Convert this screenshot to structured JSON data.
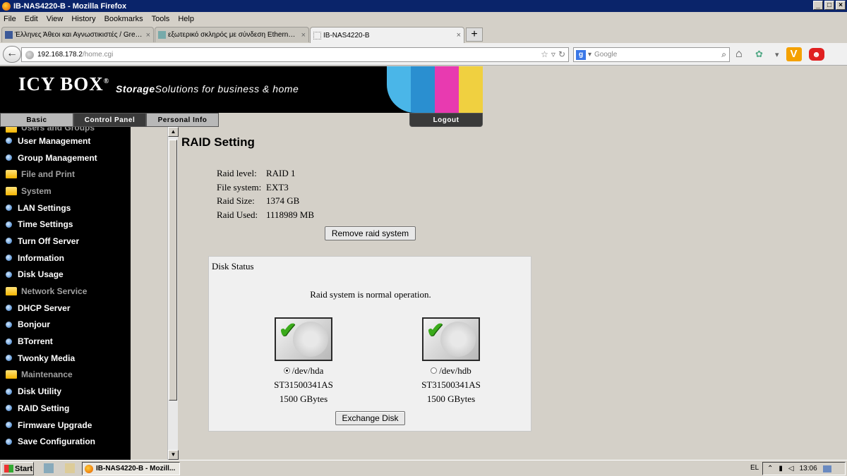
{
  "window": {
    "title": "IB-NAS4220-B - Mozilla Firefox"
  },
  "menu": [
    "File",
    "Edit",
    "View",
    "History",
    "Bookmarks",
    "Tools",
    "Help"
  ],
  "tabs": [
    {
      "label": "Έλληνες Άθεοι και Αγνωστικιστές / Gree...",
      "active": false
    },
    {
      "label": "εξωτερικό σκληρός με σύνδεση Ethernet ...",
      "active": false
    },
    {
      "label": "IB-NAS4220-B",
      "active": true
    }
  ],
  "address": {
    "host": "192.168.178.2",
    "path": "/home.cgi"
  },
  "search": {
    "placeholder": "Google"
  },
  "header": {
    "brand": "ICY BOX",
    "brand_mark": "®",
    "tagline_bold": "Storage",
    "tagline_rest": "Solutions for business & home"
  },
  "topnav": {
    "basic": "Basic",
    "control_panel": "Control Panel",
    "personal_info": "Personal Info",
    "logout": "Logout"
  },
  "sidebar": {
    "partial": "Users and Groups",
    "items": [
      {
        "label": "User Management",
        "kind": "item"
      },
      {
        "label": "Group Management",
        "kind": "item"
      },
      {
        "label": "File and Print",
        "kind": "category"
      },
      {
        "label": "System",
        "kind": "category"
      },
      {
        "label": "LAN Settings",
        "kind": "item"
      },
      {
        "label": "Time Settings",
        "kind": "item"
      },
      {
        "label": "Turn Off Server",
        "kind": "item"
      },
      {
        "label": "Information",
        "kind": "item"
      },
      {
        "label": "Disk Usage",
        "kind": "item"
      },
      {
        "label": "Network Service",
        "kind": "category"
      },
      {
        "label": "DHCP Server",
        "kind": "item"
      },
      {
        "label": "Bonjour",
        "kind": "item"
      },
      {
        "label": "BTorrent",
        "kind": "item"
      },
      {
        "label": "Twonky Media",
        "kind": "item"
      },
      {
        "label": "Maintenance",
        "kind": "category"
      },
      {
        "label": "Disk Utility",
        "kind": "item"
      },
      {
        "label": "RAID Setting",
        "kind": "item"
      },
      {
        "label": "Firmware Upgrade",
        "kind": "item"
      },
      {
        "label": "Save Configuration",
        "kind": "item"
      }
    ]
  },
  "main": {
    "title": "RAID Setting",
    "info": [
      {
        "key": "Raid level:",
        "value": "RAID 1"
      },
      {
        "key": "File system:",
        "value": "EXT3"
      },
      {
        "key": "Raid Size:",
        "value": "1374 GB"
      },
      {
        "key": "Raid Used:",
        "value": "1118989 MB"
      }
    ],
    "remove_button": "Remove raid system",
    "disk_status": {
      "title": "Disk Status",
      "status": "Raid system is normal operation.",
      "disks": [
        {
          "device": "/dev/hda",
          "model": "ST31500341AS",
          "size": "1500 GBytes",
          "selected": true
        },
        {
          "device": "/dev/hdb",
          "model": "ST31500341AS",
          "size": "1500 GBytes",
          "selected": false
        }
      ],
      "exchange_button": "Exchange Disk"
    }
  },
  "taskbar": {
    "start": "Start",
    "task": "IB-NAS4220-B - Mozill...",
    "lang": "EL",
    "time": "13:06"
  }
}
